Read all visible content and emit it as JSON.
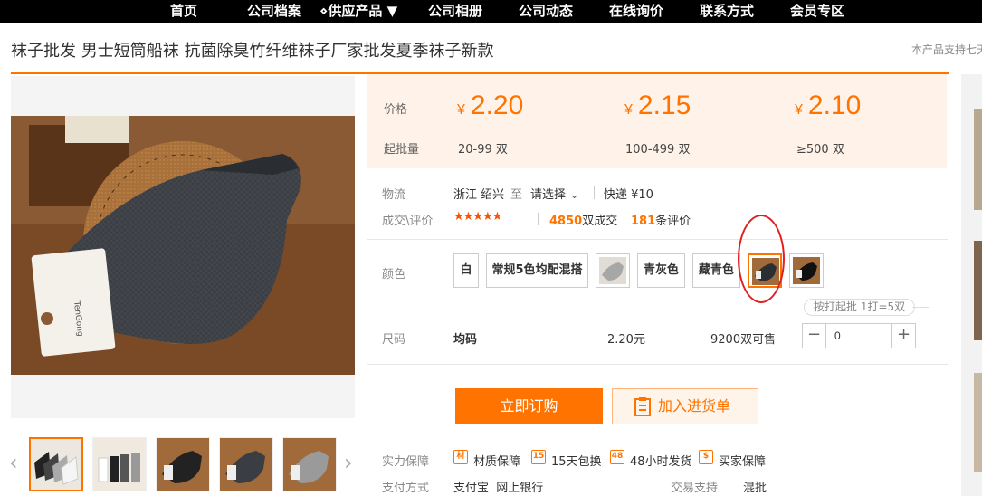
{
  "nav": {
    "items": [
      "首页",
      "公司档案",
      "⋄供应产品 ▼",
      "公司相册",
      "公司动态",
      "在线询价",
      "联系方式",
      "会员专区"
    ]
  },
  "product": {
    "title": "袜子批发 男士短筒船袜 抗菌除臭竹纤维袜子厂家批发夏季袜子新款",
    "support_note": "本产品支持七天"
  },
  "pricing": {
    "price_label": "价格",
    "moq_label": "起批量",
    "currency": "¥",
    "tiers": [
      {
        "price": "2.20",
        "range": "20-99 双"
      },
      {
        "price": "2.15",
        "range": "100-499 双"
      },
      {
        "price": "2.10",
        "range": "≥500 双"
      }
    ]
  },
  "logistics": {
    "label": "物流",
    "origin": "浙江 绍兴",
    "to": "至",
    "select": "请选择",
    "express": "快递 ¥10"
  },
  "reviews": {
    "label": "成交\\评价",
    "rating": 4.5,
    "deals_count": "4850",
    "deals_suffix": "双成交",
    "review_count": "181",
    "review_suffix": "条评价"
  },
  "colors": {
    "label": "颜色",
    "options": [
      "白",
      "常规5色均配混搭",
      "",
      "青灰色",
      "藏青色",
      "",
      ""
    ],
    "selected_index": 5
  },
  "size": {
    "label": "尺码",
    "hint": "按打起批 1打=5双",
    "name": "均码",
    "price": "2.20元",
    "stock": "9200双可售",
    "minus": "−",
    "plus": "+",
    "quantity": "0"
  },
  "actions": {
    "buy": "立即订购",
    "cart": "加入进货单"
  },
  "guarantee": {
    "label": "实力保障",
    "items": [
      {
        "icon": "材",
        "text": "材质保障"
      },
      {
        "icon": "15",
        "text": "15天包换"
      },
      {
        "icon": "48",
        "text": "48小时发货"
      },
      {
        "icon": "$",
        "text": "买家保障"
      }
    ]
  },
  "payment": {
    "label": "支付方式",
    "methods": "支付宝  网上银行",
    "trade_label": "交易支持",
    "trade_value": "混批"
  },
  "gallery": {
    "prev": "‹",
    "next": "›",
    "thumb_count": 5
  },
  "colors_palette": {
    "accent": "#ff7300",
    "price_bg": "#fff2e8",
    "nav_bg": "#000000",
    "annotation_red": "#e02020"
  }
}
